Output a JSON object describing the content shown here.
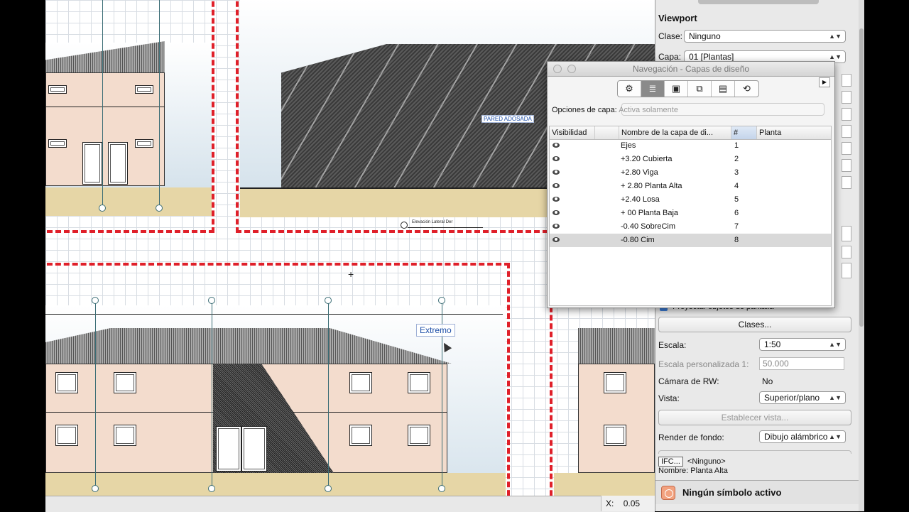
{
  "drawing": {
    "annotations": {
      "pared_adosada": "PARED ADOSADA",
      "elevation_label": "Elevación Lateral Der",
      "extremo": "Extremo",
      "cursor_plus": "+"
    },
    "colors": {
      "frame": "#e0202a",
      "wall": "#f3dccd",
      "ground": "#e6d6a6",
      "axis": "#3b6d75"
    }
  },
  "status": {
    "coord_label": "X:",
    "coord_value": "0.05"
  },
  "nav_palette": {
    "title": "Navegación - Capas de diseño",
    "tabs": [
      {
        "icon": "classes-icon"
      },
      {
        "icon": "layers-icon",
        "active": true
      },
      {
        "icon": "sheet-layers-icon"
      },
      {
        "icon": "viewports-icon"
      },
      {
        "icon": "saved-views-icon"
      },
      {
        "icon": "references-icon"
      }
    ],
    "options_label": "Opciones de capa:",
    "options_value": "Activa solamente",
    "columns": {
      "visibility": "Visibilidad",
      "name": "Nombre de la capa de di...",
      "number": "#",
      "story": "Planta"
    },
    "rows": [
      {
        "name": "Ejes",
        "num": "1"
      },
      {
        "name": "+3.20 Cubierta",
        "num": "2"
      },
      {
        "name": "+2.80 Viga",
        "num": "3"
      },
      {
        "name": "+ 2.80 Planta Alta",
        "num": "4"
      },
      {
        "name": "+2.40 Losa",
        "num": "5"
      },
      {
        "name": "+ 00 Planta Baja",
        "num": "6"
      },
      {
        "name": "-0.40 SobreCim",
        "num": "7"
      },
      {
        "name": "-0.80 Cim",
        "num": "8"
      }
    ]
  },
  "obj_info": {
    "section_title": "Viewport",
    "clase_label": "Clase:",
    "clase_value": "Ninguno",
    "capa_label": "Capa:",
    "capa_value": "01 [Plantas]",
    "proyectar_label": "Proyectar objetos de pantalla",
    "clases_button": "Clases...",
    "escala_label": "Escala:",
    "escala_value": "1:50",
    "escala_pers_label": "Escala personalizada 1:",
    "escala_pers_value": "50.000",
    "camara_label": "Cámara de RW:",
    "camara_value": "No",
    "vista_label": "Vista:",
    "vista_value": "Superior/plano",
    "establecer_button": "Establecer vista...",
    "render_label": "Render de fondo:",
    "render_value": "Dibujo alámbrico",
    "ifc_label": "IFC...",
    "ifc_value": "<Ninguno>",
    "nombre_label": "Nombre:",
    "nombre_value": "Planta Alta",
    "symbol_status": "Ningún símbolo activo"
  }
}
